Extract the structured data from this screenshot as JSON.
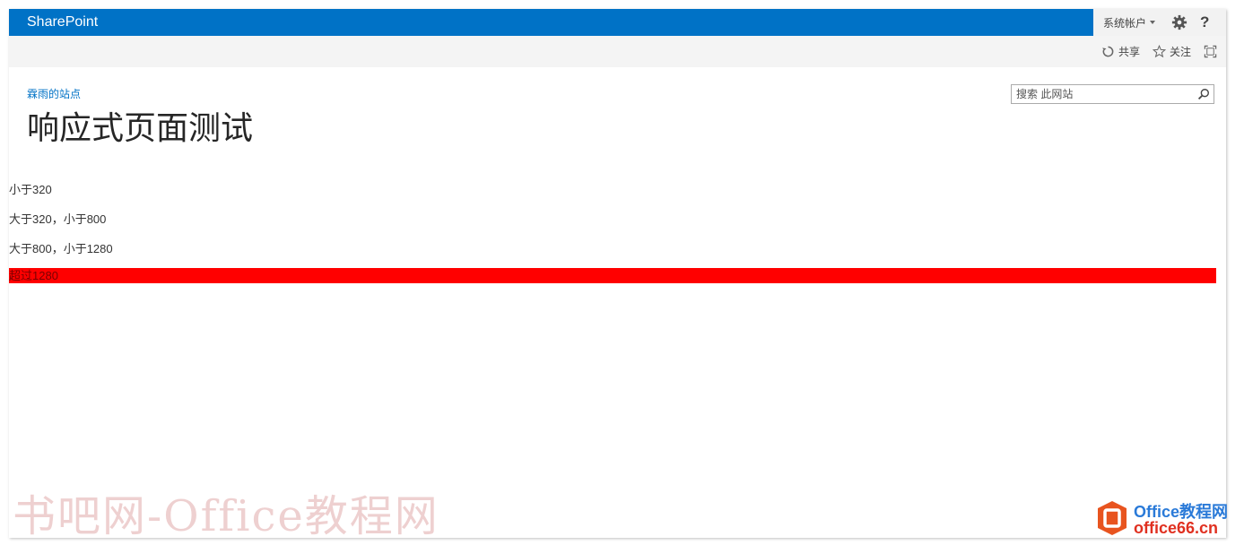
{
  "suitebar": {
    "brand": "SharePoint",
    "account_label": "系统帐户",
    "help_label": "?"
  },
  "ribbon": {
    "share_label": "共享",
    "follow_label": "关注"
  },
  "header": {
    "site_link": "霖雨的站点",
    "page_title": "响应式页面测试",
    "search_placeholder": "搜索 此网站"
  },
  "content": {
    "lines": [
      "小于320",
      "大于320，小于800",
      "大于800，小于1280"
    ],
    "highlight_line": "超过1280",
    "highlight_color": "#ff0000"
  },
  "watermark": {
    "left_text": "书吧网-Office教程网",
    "logo_line1": "Office教程网",
    "logo_line2": "office66.cn"
  },
  "colors": {
    "suitebar": "#0072c6",
    "ribbon": "#f4f4f4",
    "link": "#0072c6"
  },
  "icons": [
    "chevron-down-icon",
    "gear-icon",
    "help-icon",
    "share-icon",
    "star-icon",
    "focus-icon",
    "search-icon",
    "office-logo-icon"
  ]
}
